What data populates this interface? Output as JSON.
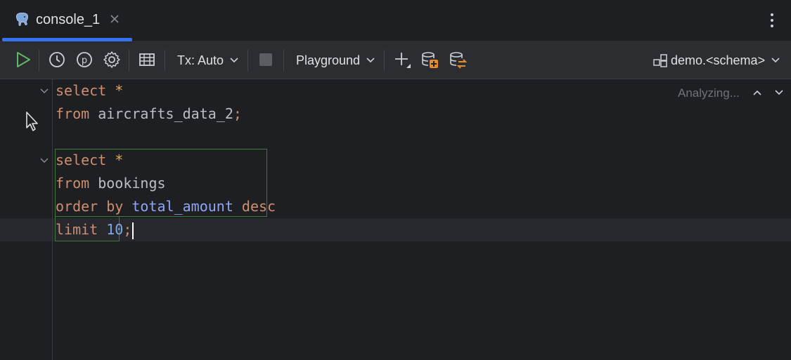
{
  "tab": {
    "label": "console_1",
    "icon": "postgresql-elephant-icon"
  },
  "toolbar": {
    "tx_label": "Tx: Auto",
    "mode_label": "Playground",
    "schema_label": "demo.<schema>"
  },
  "editor": {
    "status": "Analyzing...",
    "lines": [
      {
        "tokens": [
          {
            "t": "select",
            "c": "kw"
          },
          {
            "t": " ",
            "c": "id"
          },
          {
            "t": "*",
            "c": "star"
          }
        ]
      },
      {
        "tokens": [
          {
            "t": "from",
            "c": "kw"
          },
          {
            "t": " aircrafts_data_2",
            "c": "id"
          },
          {
            "t": ";",
            "c": "semi"
          }
        ]
      },
      {
        "tokens": []
      },
      {
        "tokens": [
          {
            "t": "select",
            "c": "kw"
          },
          {
            "t": " ",
            "c": "id"
          },
          {
            "t": "*",
            "c": "star"
          }
        ]
      },
      {
        "tokens": [
          {
            "t": "from",
            "c": "kw"
          },
          {
            "t": " bookings",
            "c": "id"
          }
        ]
      },
      {
        "tokens": [
          {
            "t": "order by",
            "c": "kw"
          },
          {
            "t": " ",
            "c": "id"
          },
          {
            "t": "total_amount",
            "c": "col"
          },
          {
            "t": " ",
            "c": "id"
          },
          {
            "t": "desc",
            "c": "kw"
          }
        ]
      },
      {
        "tokens": [
          {
            "t": "limit",
            "c": "kw"
          },
          {
            "t": " ",
            "c": "id"
          },
          {
            "t": "10",
            "c": "num"
          },
          {
            "t": ";",
            "c": "semi"
          }
        ]
      }
    ]
  },
  "colors": {
    "accent": "#3574f0",
    "run_green": "#5fb865",
    "keyword": "#cf8e6d",
    "column": "#8fa6f7",
    "statement_border": "#3f7a3a"
  }
}
